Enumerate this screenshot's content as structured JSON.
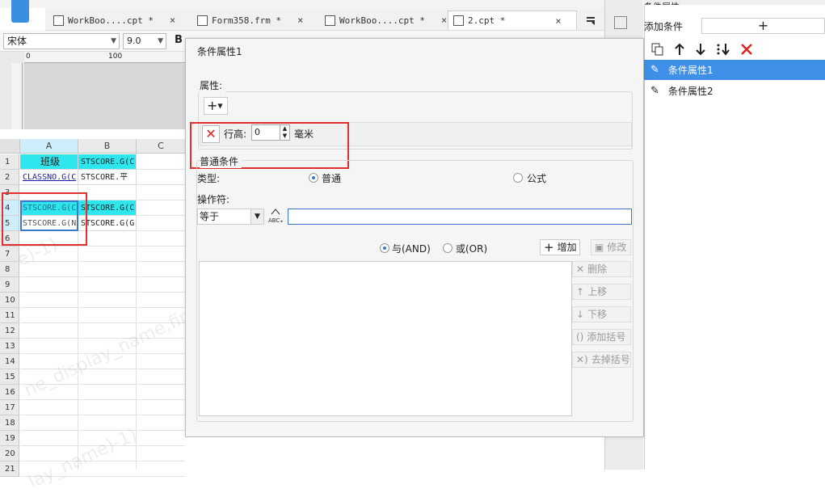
{
  "tabs": [
    {
      "label": "WorkBoo....cpt *",
      "close": "×"
    },
    {
      "label": "Form358.frm *",
      "close": "×"
    },
    {
      "label": "WorkBoo....cpt *",
      "close": "×"
    },
    {
      "label": "2.cpt *",
      "close": "×",
      "active": true
    }
  ],
  "format_toolbar": {
    "font": "宋体",
    "size": "9.0",
    "bold": "B"
  },
  "ruler": {
    "mark0": "0",
    "mark100": "100"
  },
  "sheet": {
    "columns": [
      "A",
      "B",
      "C"
    ],
    "rows": [
      "1",
      "2",
      "3",
      "4",
      "5",
      "6",
      "7",
      "8",
      "9",
      "10",
      "11",
      "12",
      "13",
      "14",
      "15",
      "16",
      "17",
      "18",
      "19",
      "20",
      "21"
    ],
    "cells": {
      "a1": "班级",
      "b1": "STSCORE.G(C",
      "a2": "CLASSNO.G(C",
      "b2": "STSCORE.平",
      "a4": "STSCORE.G(C",
      "b4": "STSCORE.G(C",
      "a5": "STSCORE.G(N",
      "b5": "STSCORE.G(G"
    }
  },
  "right_panel": {
    "title": "条件属性",
    "add_condition_label": "添加条件",
    "add_symbol": "+",
    "tools": [
      "copy",
      "up",
      "down",
      "move-bottom",
      "delete"
    ],
    "items": [
      {
        "label": "条件属性1",
        "selected": true
      },
      {
        "label": "条件属性2",
        "selected": false
      }
    ]
  },
  "dialog": {
    "title": "条件属性1",
    "attr_label": "属性:",
    "add_attr_symbol": "+",
    "row_height_label": "行高:",
    "row_height_value": "0",
    "unit": "毫米",
    "normal_cond_label": "普通条件",
    "type_label": "类型:",
    "type_ordinary": "普通",
    "type_formula": "公式",
    "type_selected": "ordinary",
    "operator_label": "操作符:",
    "operator_value": "等于",
    "and_label": "与(AND)",
    "or_label": "或(OR)",
    "logic_selected": "and",
    "buttons": {
      "add": "增加",
      "edit": "修改",
      "delete": "删除",
      "move_up": "上移",
      "move_down": "下移",
      "add_bracket": "添加括号",
      "remove_bracket": "去掉括号"
    }
  },
  "colors": {
    "accent": "#3f8ee8",
    "highlight_red": "#e03030",
    "cell_cyan": "#2ee6ee"
  }
}
